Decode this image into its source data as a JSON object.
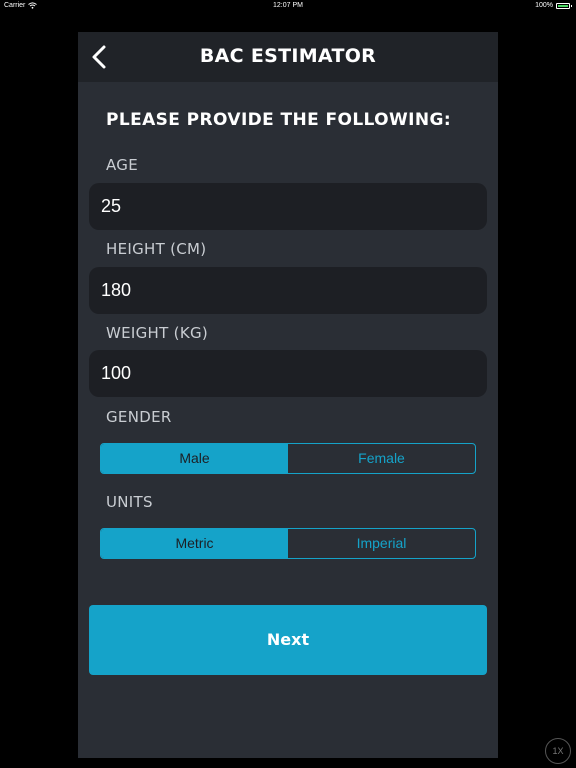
{
  "status_bar": {
    "carrier": "Carrier",
    "time": "12:07 PM",
    "battery_percent": "100%",
    "icons": [
      "wifi-icon",
      "battery-icon"
    ]
  },
  "nav": {
    "title": "BAC ESTIMATOR",
    "back_icon": "chevron-left-icon"
  },
  "form": {
    "heading": "PLEASE PROVIDE THE FOLLOWING:",
    "age": {
      "label": "AGE",
      "value": "25"
    },
    "height": {
      "label": "HEIGHT (CM)",
      "value": "180"
    },
    "weight": {
      "label": "WEIGHT (KG)",
      "value": "100"
    },
    "gender": {
      "label": "GENDER",
      "options": [
        "Male",
        "Female"
      ],
      "selected": "Male"
    },
    "units": {
      "label": "UNITS",
      "options": [
        "Metric",
        "Imperial"
      ],
      "selected": "Metric"
    }
  },
  "next_button": {
    "label": "Next"
  },
  "zoom_badge": "1X",
  "colors": {
    "accent": "#15a3c9",
    "background": "#2a2e35",
    "navbar": "#202328",
    "field": "#1d1f24"
  }
}
